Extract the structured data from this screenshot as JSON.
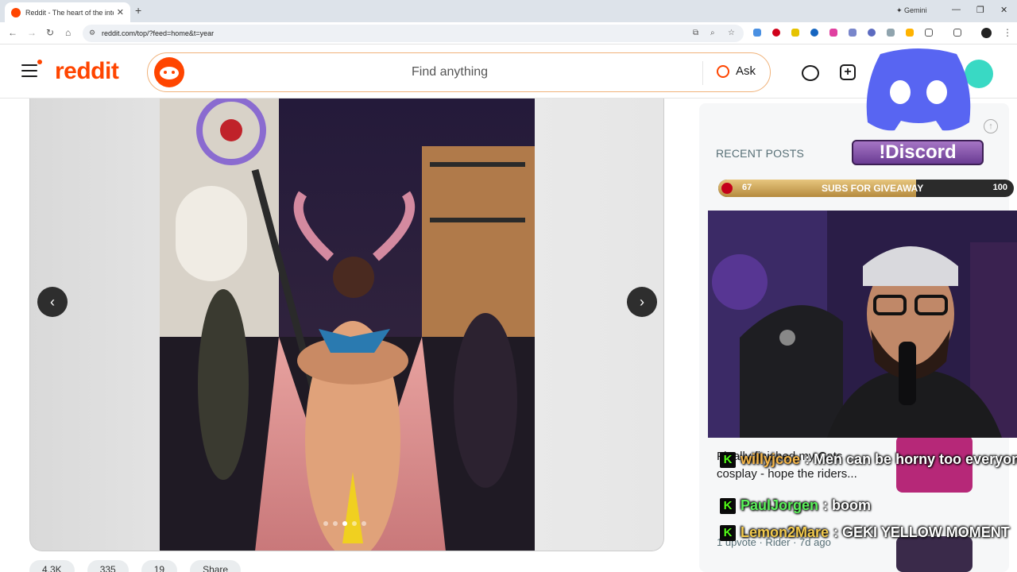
{
  "browser": {
    "tab_title": "Reddit - The heart of the internet",
    "tab_close": "✕",
    "new_tab": "+",
    "gemini_label": "Gemini",
    "url": "reddit.com/top/?feed=home&t=year",
    "window_controls": [
      "—",
      "❐",
      "✕"
    ]
  },
  "header": {
    "logo_text": "reddit",
    "search_placeholder": "Find anything",
    "ask_label": "Ask"
  },
  "post": {
    "carousel_prev": "‹",
    "carousel_next": "›",
    "image_count": 5,
    "active_image_index": 2,
    "action_pills": [
      "4.3K",
      "335",
      "19",
      "Share"
    ]
  },
  "sidebar": {
    "recent_title": "RECENT POSTS",
    "post_title": "Finally finished my Cats cosplay - hope the riders...",
    "post_meta": "1 upvote · Rider · 7d ago"
  },
  "overlay": {
    "discord_label": "!Discord",
    "sub_goal": {
      "current": "67",
      "label": "SUBS FOR GIVEAWAY",
      "max": "100",
      "fraction": 0.67
    },
    "chat": [
      {
        "user": "willyjcoe",
        "message": ": Men can be horny too everyone",
        "color": "#f5b64a"
      },
      {
        "user": "PaulJorgen",
        "message": ": boom",
        "color": "#5bf05b"
      },
      {
        "user": "Lemon2Mare",
        "message": ": GEKI YELLOW MOMENT",
        "color": "#f2c94c"
      }
    ]
  }
}
